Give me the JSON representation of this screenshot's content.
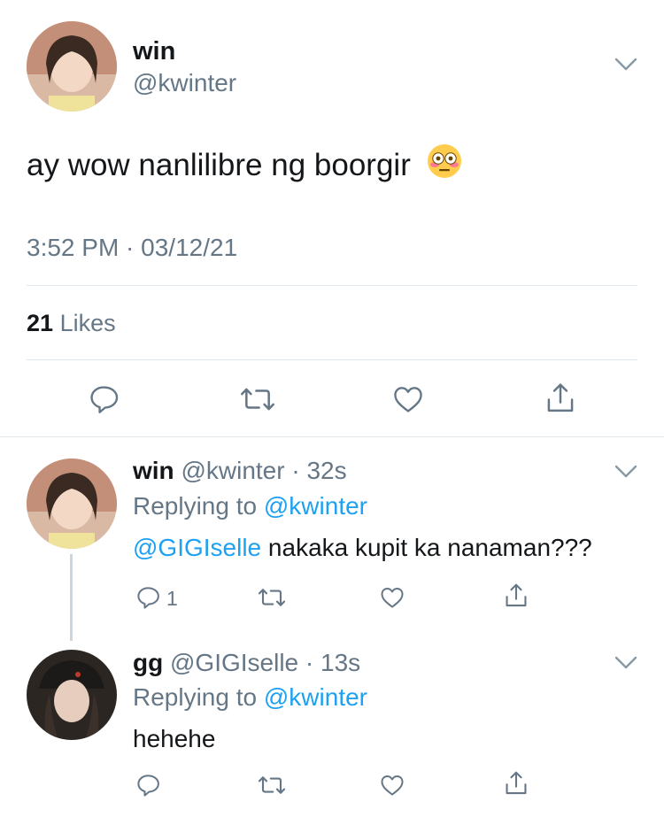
{
  "main_tweet": {
    "author_name": "win",
    "author_handle": "@kwinter",
    "text": "ay wow nanlilibre ng boorgir",
    "emoji": "😳",
    "timestamp": "3:52 PM · 03/12/21",
    "likes_count": "21",
    "likes_label": "Likes",
    "actions": [
      "reply-icon",
      "retweet-icon",
      "like-icon",
      "share-icon"
    ]
  },
  "replies": [
    {
      "author_name": "win",
      "author_handle": "@kwinter",
      "time": "32s",
      "replying_prefix": "Replying to",
      "replying_to": "@kwinter",
      "mention": "@GIGIselle",
      "text": " nakaka kupit ka nanaman???",
      "reply_count": "1"
    },
    {
      "author_name": "gg",
      "author_handle": "@GIGIselle",
      "time": "13s",
      "replying_prefix": "Replying to",
      "replying_to": "@kwinter",
      "text": "hehehe",
      "reply_count": ""
    }
  ],
  "colors": {
    "text": "#14171a",
    "muted": "#657786",
    "link": "#1da1f2",
    "divider": "#e1e8ed"
  }
}
